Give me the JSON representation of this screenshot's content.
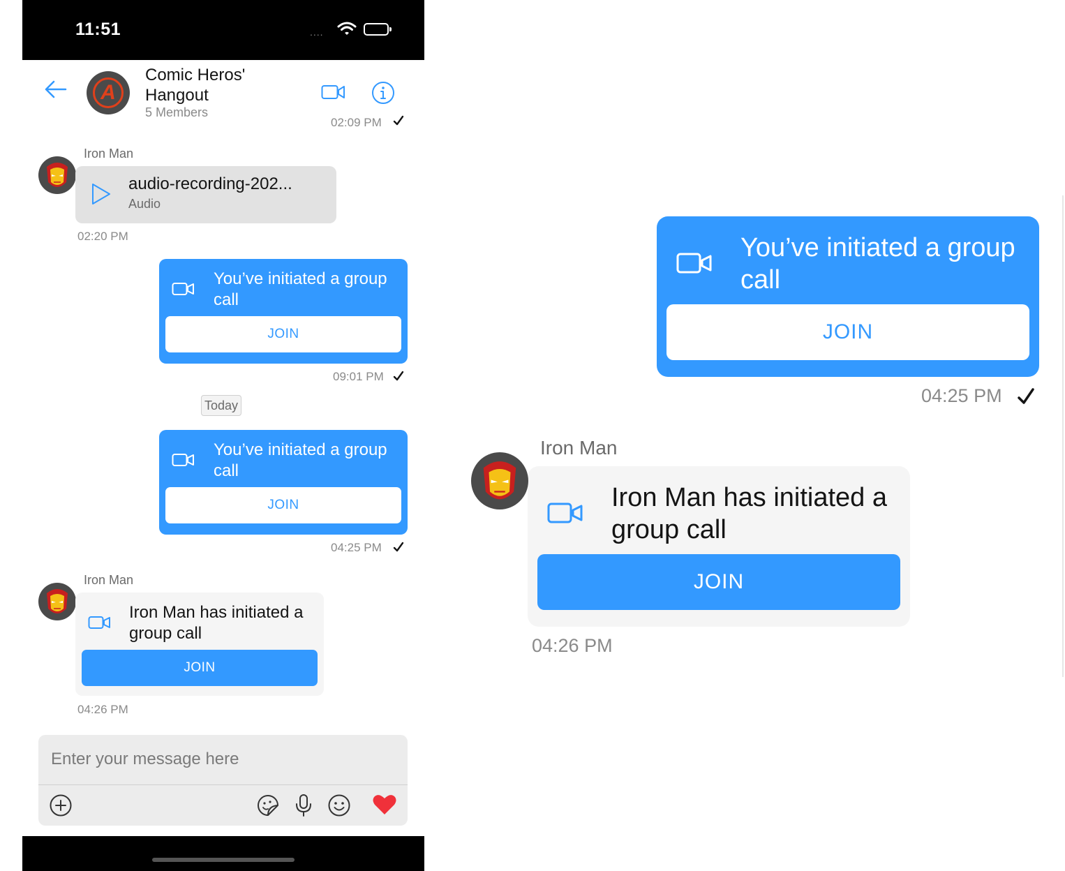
{
  "status_bar": {
    "time": "11:51",
    "signal": "...."
  },
  "header": {
    "group_name": "Comic Heros' Hangout",
    "members": "5 Members",
    "partial_timestamp": "02:09 PM"
  },
  "messages": [
    {
      "sender": "Iron Man",
      "type": "audio",
      "title": "audio-recording-202...",
      "subtitle": "Audio",
      "time": "02:20 PM"
    },
    {
      "type": "call_outgoing",
      "text": "You’ve initiated a group call",
      "join_label": "JOIN",
      "time": "09:01 PM"
    },
    {
      "type": "date_separator",
      "label": "Today"
    },
    {
      "type": "call_outgoing",
      "text": "You’ve initiated a group call",
      "join_label": "JOIN",
      "time": "04:25 PM"
    },
    {
      "sender": "Iron Man",
      "type": "call_incoming",
      "text": "Iron Man has initiated a group call",
      "join_label": "JOIN",
      "time": "04:26 PM"
    }
  ],
  "composer": {
    "placeholder": "Enter your message here"
  },
  "zoom": {
    "outgoing": {
      "text": "You’ve initiated a group call",
      "join_label": "JOIN",
      "time": "04:25 PM"
    },
    "incoming": {
      "sender": "Iron Man",
      "text": "Iron Man has initiated a group call",
      "join_label": "JOIN",
      "time": "04:26 PM"
    }
  },
  "colors": {
    "accent": "#3399ff",
    "heart": "#f0313a",
    "incoming_bubble": "#f5f5f5",
    "audio_bubble": "#e2e2e2"
  },
  "icons": [
    "back-arrow-icon",
    "video-call-icon",
    "info-icon",
    "play-icon",
    "check-icon",
    "add-icon",
    "sticker-icon",
    "microphone-icon",
    "emoji-icon",
    "heart-icon"
  ]
}
